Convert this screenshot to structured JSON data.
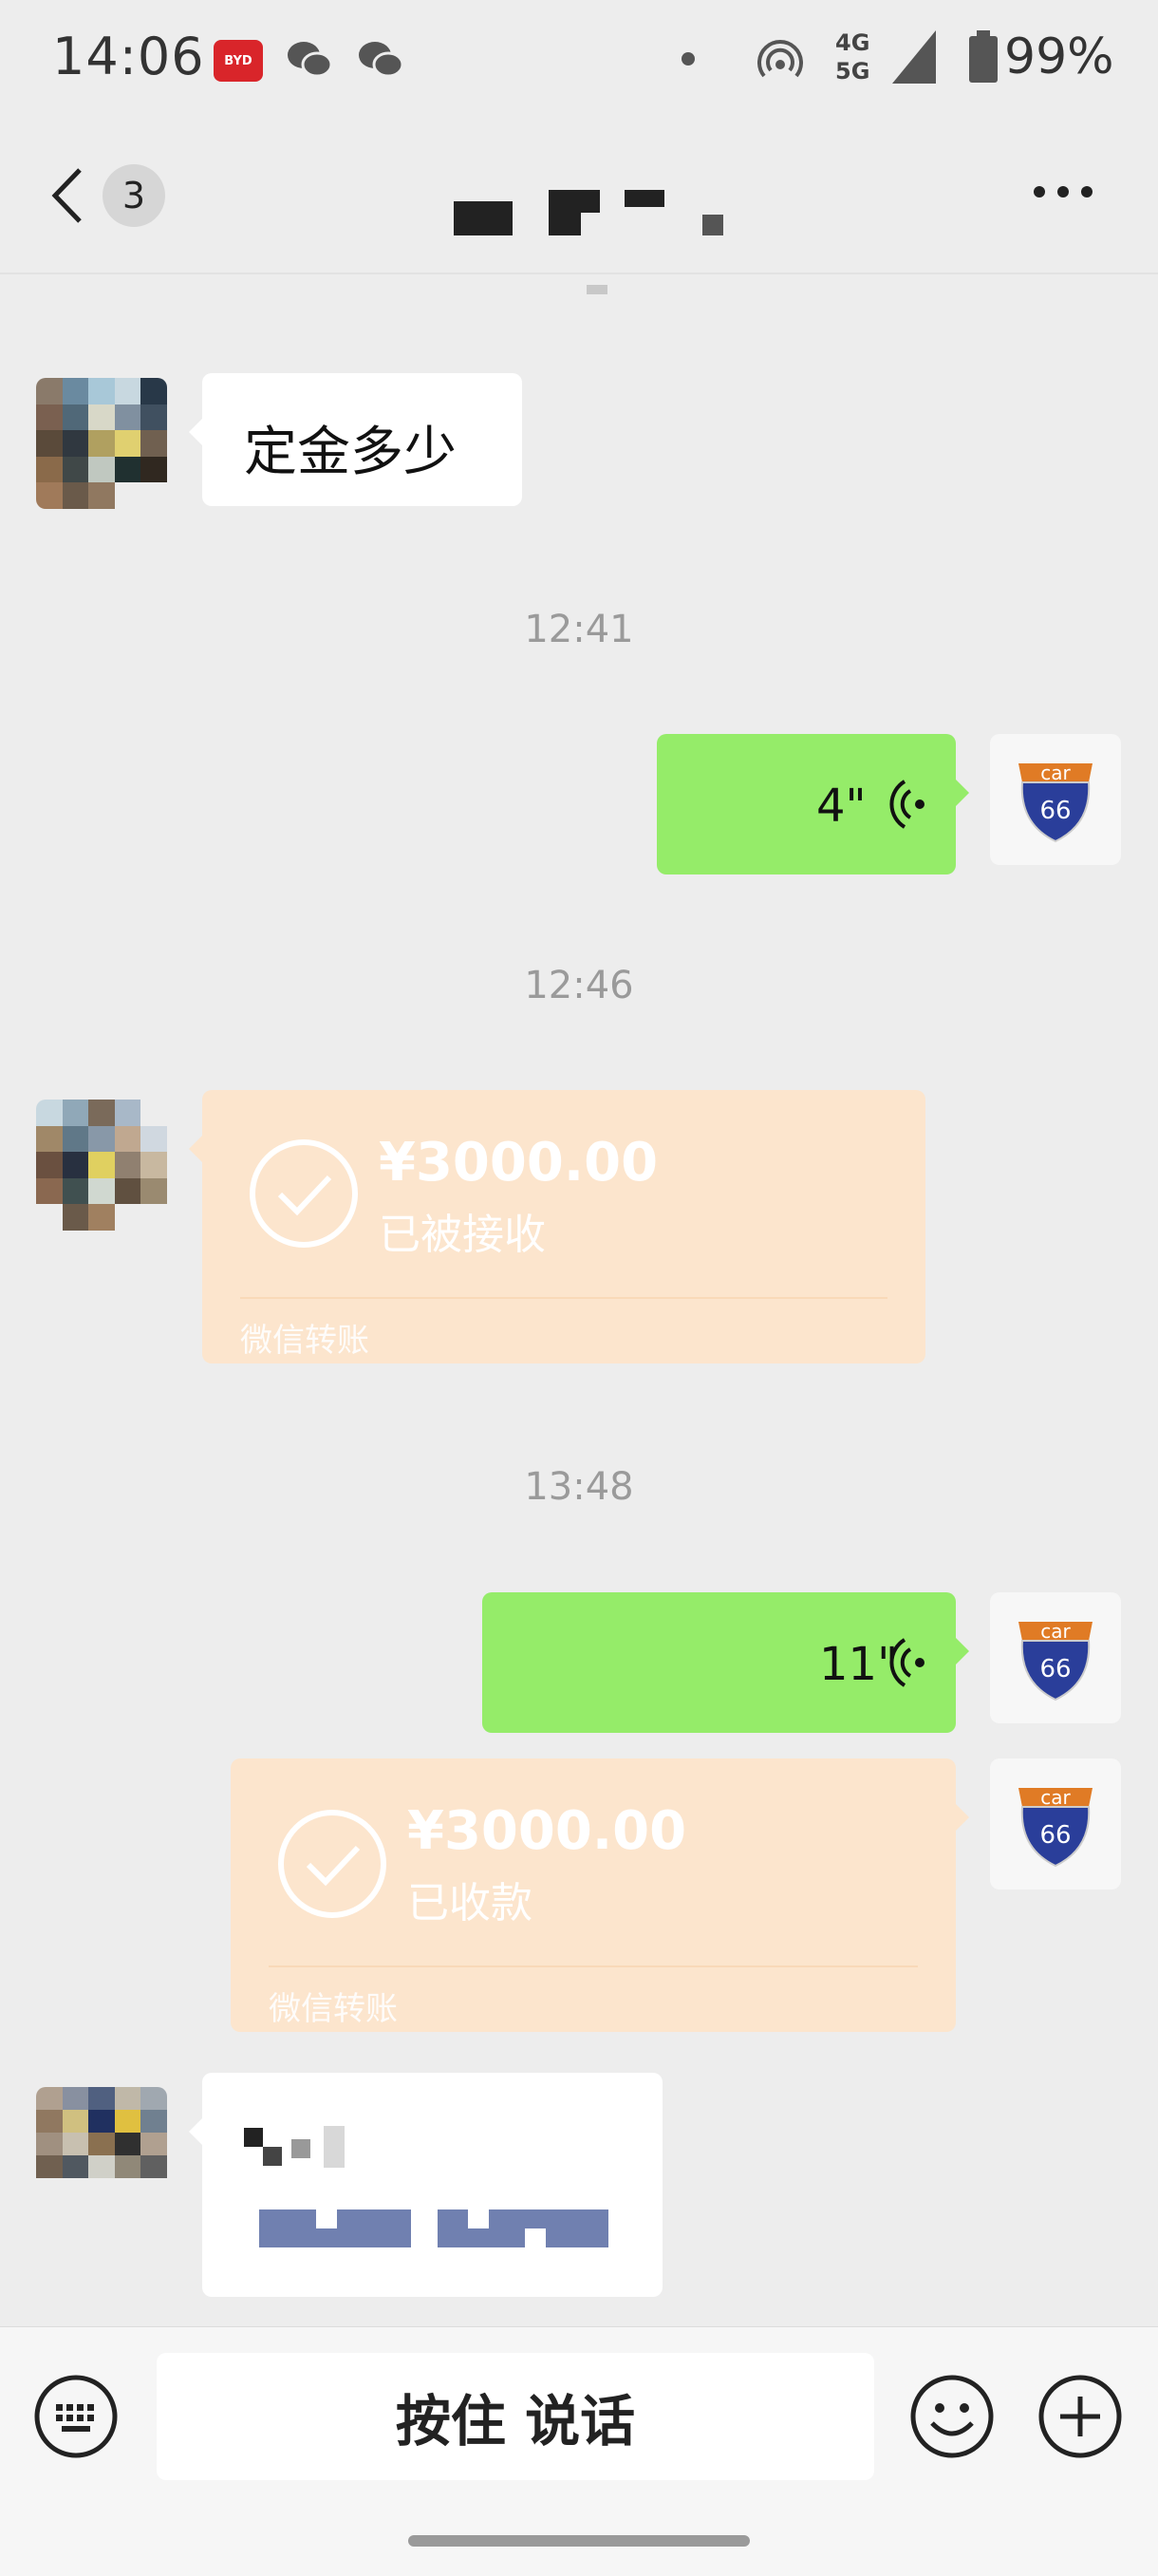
{
  "status_bar": {
    "time": "14:06",
    "app_badge": "BYD",
    "network_top": "4G",
    "network_bottom": "5G",
    "battery": "99%"
  },
  "header": {
    "unread_count": "3",
    "title": "■ ■▀ ▬ ▪"
  },
  "messages": [
    {
      "type": "text",
      "side": "left",
      "text": "定金多少"
    },
    {
      "type": "timestamp",
      "text": "12:41"
    },
    {
      "type": "voice",
      "side": "right",
      "duration": "4\""
    },
    {
      "type": "timestamp",
      "text": "12:46"
    },
    {
      "type": "transfer",
      "side": "left",
      "amount": "¥3000.00",
      "status": "已被接收",
      "label": "微信转账"
    },
    {
      "type": "timestamp",
      "text": "13:48"
    },
    {
      "type": "voice",
      "side": "right",
      "duration": "11\""
    },
    {
      "type": "transfer",
      "side": "right",
      "amount": "¥3000.00",
      "status": "已收款",
      "label": "微信转账"
    },
    {
      "type": "text",
      "side": "left",
      "text": ""
    }
  ],
  "input_bar": {
    "voice_hold_label": "按住 说话"
  },
  "contact_avatar_label": "car 66",
  "colors": {
    "chat_bg": "#ededed",
    "green_bubble": "#95ec69",
    "transfer_bubble": "#fce5cd",
    "white_bubble": "#ffffff"
  }
}
